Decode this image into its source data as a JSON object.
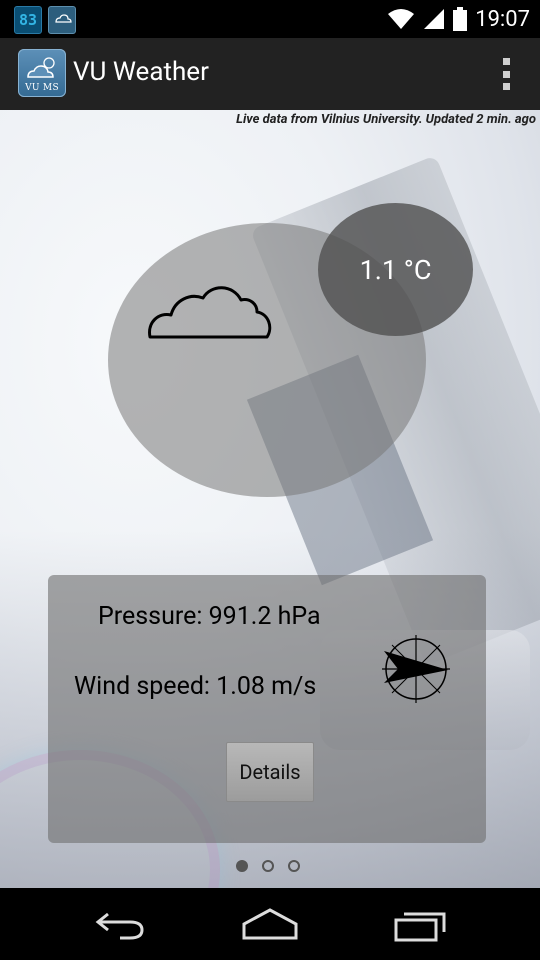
{
  "status_bar": {
    "notification_badge": "83",
    "clock": "19:07",
    "icons": [
      "wifi-icon",
      "signal-icon",
      "battery-icon"
    ]
  },
  "action_bar": {
    "app_icon_text": "VU MS",
    "title": "VU Weather"
  },
  "main": {
    "live_caption": "Live data from Vilnius University. Updated 2 min. ago",
    "weather_icon": "cloud-icon",
    "temperature": "1.1 °C",
    "pressure": "Pressure: 991.2 hPa",
    "wind_speed": "Wind speed: 1.08 m/s",
    "wind_direction_icon": "compass-arrow-icon",
    "details_label": "Details"
  },
  "pager": {
    "pages": 3,
    "active_index": 0
  },
  "colors": {
    "accent": "#33b5e5",
    "action_bar": "#222222",
    "circle": "#787878"
  }
}
